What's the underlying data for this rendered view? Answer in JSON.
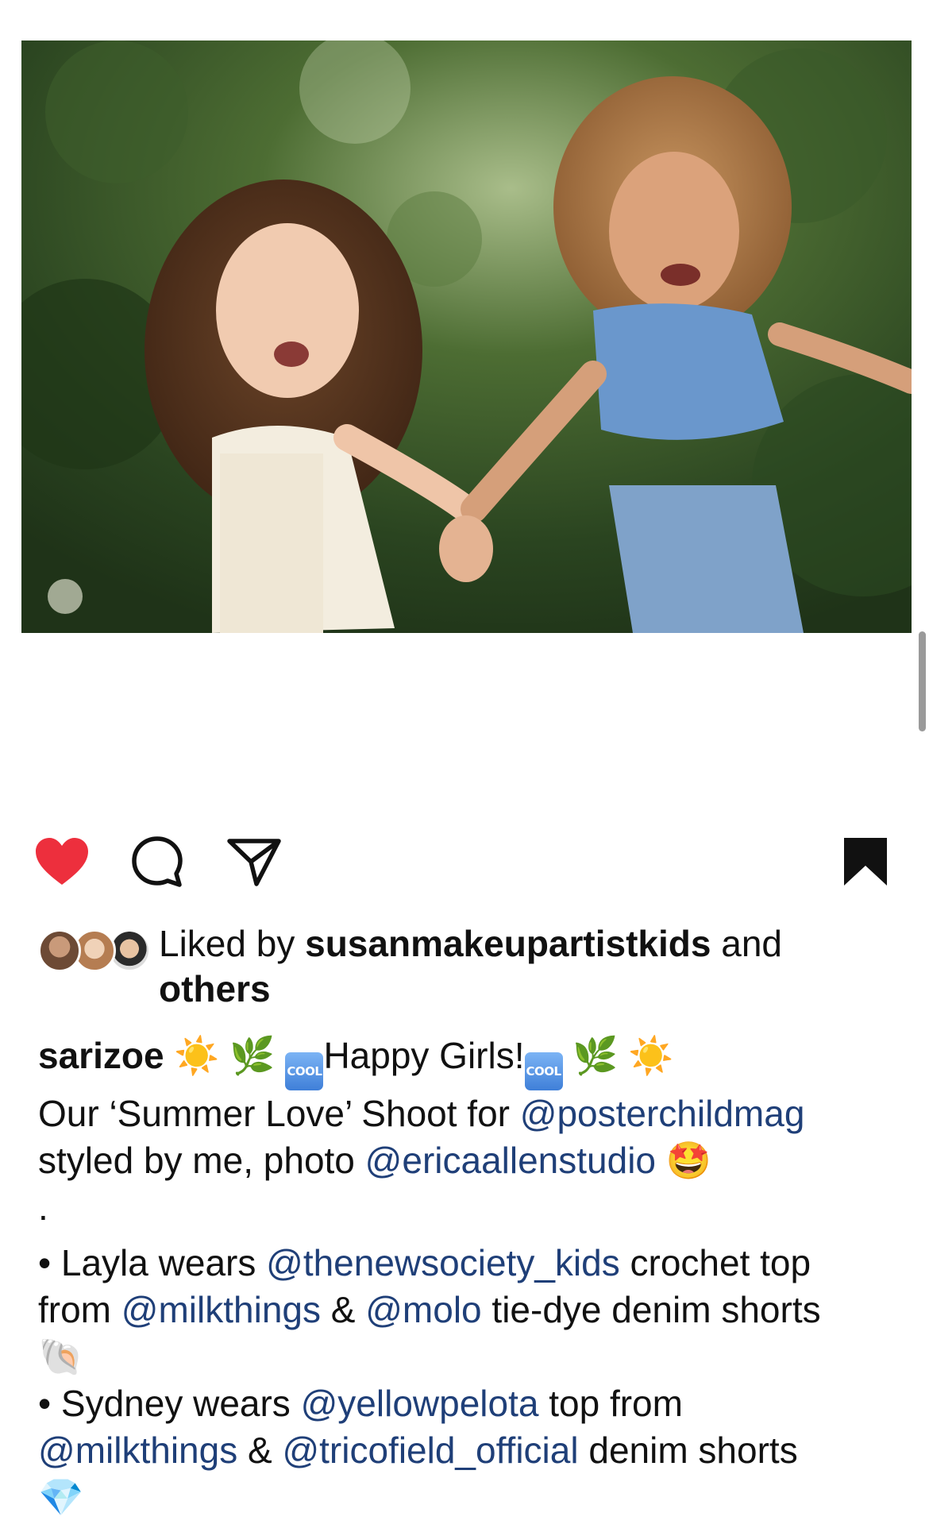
{
  "post": {
    "image_alt": "Two girls holding hands outdoors"
  },
  "actions": {
    "like_icon": "heart-filled-icon",
    "comment_icon": "comment-bubble-icon",
    "share_icon": "paper-plane-icon",
    "save_icon": "bookmark-filled-icon",
    "like_color": "#ed2f3d"
  },
  "likes": {
    "prefix": "Liked by",
    "user": "susanmakeupartistkids",
    "conjunction": "and",
    "others": "others"
  },
  "caption": {
    "username": "sarizoe",
    "title_text": "Happy Girls!",
    "emoji_sun": "☀️",
    "emoji_herb": "🌿",
    "badge_cool": "COOL",
    "line1_pre": "Our ‘Summer Love’ Shoot for",
    "mention_posterchildmag": "@posterchildmag",
    "line2_pre": "styled by me, photo",
    "mention_ericaallenstudio": "@ericaallenstudio",
    "emoji_star_eyes": "🤩",
    "dot": ".",
    "bullet": "•",
    "layla_pre": "Layla wears",
    "mention_thenewsociety": "@thenewsociety_kids",
    "layla_mid": "crochet top",
    "from": "from",
    "mention_milkthings": "@milkthings",
    "amp": "&",
    "mention_molo": "@molo",
    "layla_end": "tie-dye denim shorts",
    "emoji_shell": "🐚",
    "sydney_pre": "Sydney wears",
    "mention_yellowpelota": "@yellowpelota",
    "sydney_mid": "top from",
    "mention_tricofield": "@tricofield_official",
    "sydney_end": "denim shorts",
    "emoji_gem": "💎"
  }
}
